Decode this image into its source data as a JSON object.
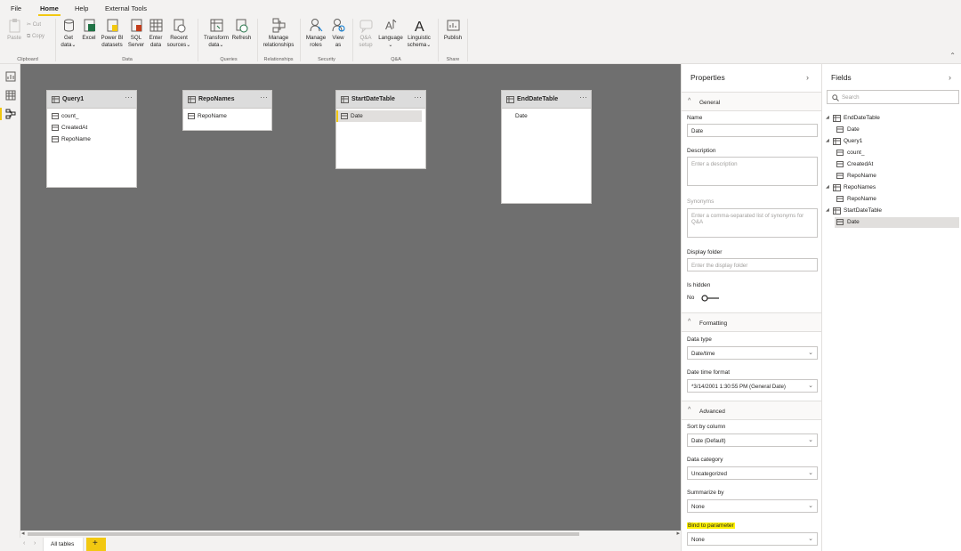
{
  "menu": {
    "file": "File",
    "home": "Home",
    "help": "Help",
    "external_tools": "External Tools"
  },
  "ribbon": {
    "clipboard": {
      "paste": "Paste",
      "cut": "Cut",
      "copy": "Copy",
      "group": "Clipboard"
    },
    "data": {
      "get_data": [
        "Get",
        "data"
      ],
      "excel": "Excel",
      "power_bi": [
        "Power BI",
        "datasets"
      ],
      "sql": [
        "SQL",
        "Server"
      ],
      "enter_data": [
        "Enter",
        "data"
      ],
      "recent": [
        "Recent",
        "sources"
      ],
      "group": "Data"
    },
    "queries": {
      "transform": [
        "Transform",
        "data"
      ],
      "refresh": "Refresh",
      "group": "Queries"
    },
    "relationships": {
      "manage": [
        "Manage",
        "relationships"
      ],
      "group": "Relationships"
    },
    "security": {
      "manage_roles": [
        "Manage",
        "roles"
      ],
      "view_as": [
        "View",
        "as"
      ],
      "group": "Security"
    },
    "qa": {
      "qa_setup": [
        "Q&A",
        "setup"
      ],
      "language": "Language",
      "linguistic": [
        "Linguistic",
        "schema"
      ],
      "group": "Q&A"
    },
    "share": {
      "publish": "Publish",
      "group": "Share"
    }
  },
  "tables": [
    {
      "name": "Query1",
      "columns": [
        "count_",
        "CreatedAt",
        "RepoName"
      ]
    },
    {
      "name": "RepoNames",
      "columns": [
        "RepoName"
      ]
    },
    {
      "name": "StartDateTable",
      "columns": [
        "Date"
      ]
    },
    {
      "name": "EndDateTable",
      "columns": [
        "Date"
      ]
    }
  ],
  "bottom": {
    "all_tables": "All tables",
    "add": "+"
  },
  "properties": {
    "title": "Properties",
    "general": "General",
    "name_label": "Name",
    "name_value": "Date",
    "description_label": "Description",
    "description_placeholder": "Enter a description",
    "synonyms_label": "Synonyms",
    "synonyms_placeholder": "Enter a comma-separated list of synonyms for Q&A",
    "display_folder_label": "Display folder",
    "display_folder_placeholder": "Enter the display folder",
    "is_hidden_label": "Is hidden",
    "is_hidden_value": "No",
    "formatting": "Formatting",
    "data_type_label": "Data type",
    "data_type_value": "Date/time",
    "date_format_label": "Date time format",
    "date_format_value": "*3/14/2001 1:30:55 PM (General Date)",
    "advanced": "Advanced",
    "sort_label": "Sort by column",
    "sort_value": "Date (Default)",
    "category_label": "Data category",
    "category_value": "Uncategorized",
    "summarize_label": "Summarize by",
    "summarize_value": "None",
    "bind_label": "Bind to parameter",
    "bind_value": "None"
  },
  "fields": {
    "title": "Fields",
    "search_placeholder": "Search",
    "tree": [
      {
        "table": "EndDateTable",
        "columns": [
          "Date"
        ]
      },
      {
        "table": "Query1",
        "columns": [
          "count_",
          "CreatedAt",
          "RepoName"
        ]
      },
      {
        "table": "RepoNames",
        "columns": [
          "RepoName"
        ]
      },
      {
        "table": "StartDateTable",
        "columns": [
          "Date"
        ]
      }
    ]
  },
  "colors": {
    "accent": "#f2c811",
    "canvas": "#6f6f6f",
    "highlight": "#fff200"
  }
}
